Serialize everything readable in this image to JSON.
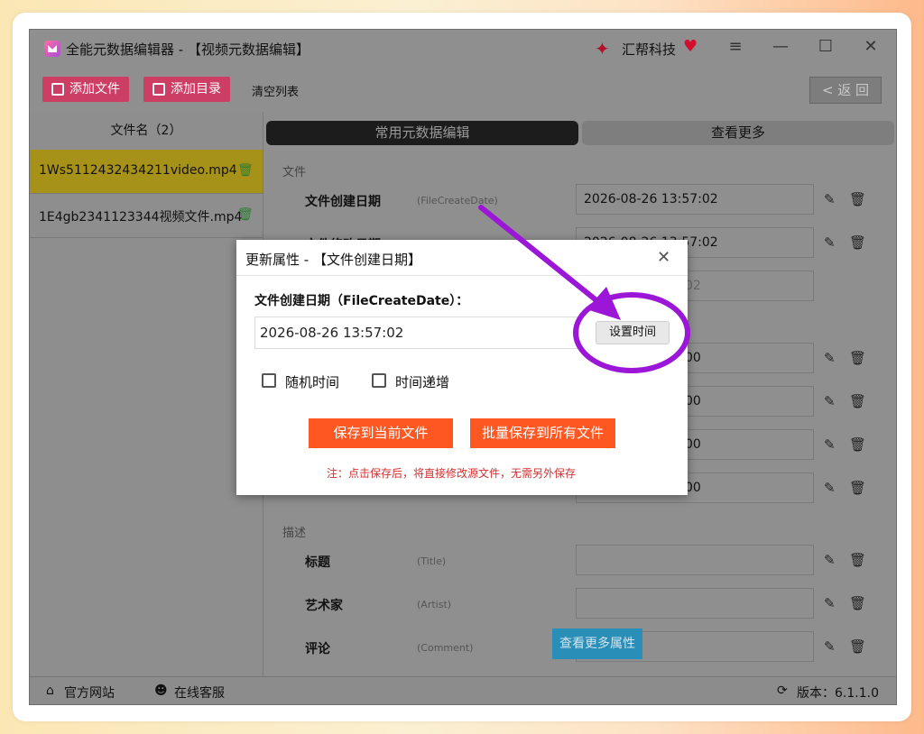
{
  "app": {
    "title": "全能元数据编辑器 - 【视频元数据编辑】",
    "brand": "汇帮科技",
    "window_controls": {
      "menu": "≡",
      "minimize": "—",
      "maximize": "☐",
      "close": "✕"
    }
  },
  "toolbar": {
    "add_file": "添加文件",
    "add_dir": "添加目录",
    "clear_list": "清空列表",
    "back": "< 返 回"
  },
  "file_list": {
    "header": "文件名（2）",
    "items": [
      {
        "name": "1Ws5112432434211video.mp4",
        "selected": true
      },
      {
        "name": "1E4gb2341123344视频文件.mp4",
        "selected": false
      }
    ]
  },
  "tabs": {
    "common": "常用元数据编辑",
    "more": "查看更多"
  },
  "sections": {
    "file": "文件",
    "description": "描述"
  },
  "fields": {
    "create": {
      "label": "文件创建日期",
      "key": "(FileCreateDate)",
      "value": "2026-08-26 13:57:02"
    },
    "modify": {
      "label": "文件修改日期",
      "value": "2026-08-26 13:57:02"
    },
    "row3": {
      "value": "02"
    },
    "row4": {
      "value": "00"
    },
    "row5": {
      "value": "00"
    },
    "row6": {
      "value": "00"
    },
    "row7": {
      "value": "00"
    },
    "title": {
      "label": "标题",
      "key": "(Title)",
      "value": ""
    },
    "artist": {
      "label": "艺术家",
      "key": "(Artist)",
      "value": ""
    },
    "comment": {
      "label": "评论",
      "key": "(Comment)",
      "value": ""
    }
  },
  "see_more_attrs": "查看更多属性",
  "status_bar": {
    "website": "官方网站",
    "support": "在线客服",
    "version": "版本：6.1.1.0"
  },
  "dialog": {
    "title": "更新属性 - 【文件创建日期】",
    "close": "✕",
    "field_label": "文件创建日期（FileCreateDate）：",
    "value": "2026-08-26 13:57:02",
    "set_time": "设置时间",
    "random_time": "随机时间",
    "incremental_time": "时间递增",
    "save_current": "保存到当前文件",
    "save_all": "批量保存到所有文件",
    "note": "注：点击保存后，将直接修改源文件，无需另外保存"
  },
  "colors": {
    "accent_pink": "#cc3e63",
    "save_orange": "#ff5722",
    "annotation_purple": "#9b16d6",
    "selected_row": "#a69219",
    "note_red": "#d32f2f"
  },
  "icons": {
    "edit": "✎",
    "delete": "🗑",
    "home": "⌂",
    "support": "☻",
    "refresh": "⟳"
  }
}
